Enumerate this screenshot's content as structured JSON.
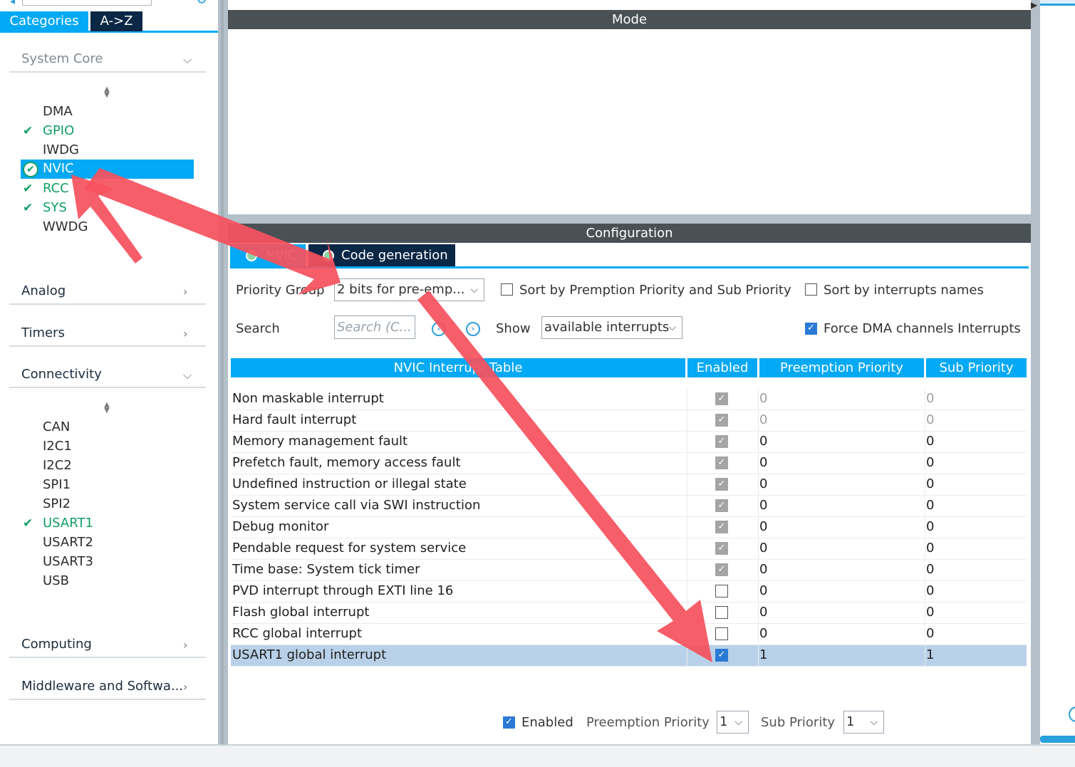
{
  "left": {
    "tabs": {
      "categories": "Categories",
      "az": "A->Z"
    },
    "sections": {
      "system_core": "System Core",
      "analog": "Analog",
      "timers": "Timers",
      "connectivity": "Connectivity",
      "computing": "Computing",
      "middleware": "Middleware and Softwa..."
    },
    "system_core_items": [
      "DMA",
      "GPIO",
      "IWDG",
      "NVIC",
      "RCC",
      "SYS",
      "WWDG"
    ],
    "connectivity_items": [
      "CAN",
      "I2C1",
      "I2C2",
      "SPI1",
      "SPI2",
      "USART1",
      "USART2",
      "USART3",
      "USB"
    ]
  },
  "main": {
    "mode_bar": "Mode",
    "config_bar": "Configuration",
    "tabs": {
      "nvic": "NVIC",
      "code": "Code generation"
    },
    "priority_group_label": "Priority Group",
    "priority_group_value": "2 bits for pre-emp...",
    "sort_premption": "Sort by Premption Priority and Sub Priority",
    "sort_names": "Sort by interrupts names",
    "search_label": "Search",
    "search_placeholder": "Search (C...",
    "show_label": "Show",
    "show_value": "available interrupts",
    "force_dma": "Force DMA channels Interrupts",
    "table": {
      "headers": [
        "NVIC Interrupt Table",
        "Enabled",
        "Preemption Priority",
        "Sub Priority"
      ],
      "rows": [
        {
          "name": "Non maskable interrupt",
          "pre": "0",
          "sub": "0"
        },
        {
          "name": "Hard fault interrupt",
          "pre": "0",
          "sub": "0"
        },
        {
          "name": "Memory management fault",
          "pre": "0",
          "sub": "0"
        },
        {
          "name": "Prefetch fault, memory access fault",
          "pre": "0",
          "sub": "0"
        },
        {
          "name": "Undefined instruction or illegal state",
          "pre": "0",
          "sub": "0"
        },
        {
          "name": "System service call via SWI instruction",
          "pre": "0",
          "sub": "0"
        },
        {
          "name": "Debug monitor",
          "pre": "0",
          "sub": "0"
        },
        {
          "name": "Pendable request for system service",
          "pre": "0",
          "sub": "0"
        },
        {
          "name": "Time base: System tick timer",
          "pre": "0",
          "sub": "0"
        },
        {
          "name": "PVD interrupt through EXTI line 16",
          "pre": "0",
          "sub": "0"
        },
        {
          "name": "Flash global interrupt",
          "pre": "0",
          "sub": "0"
        },
        {
          "name": "RCC global interrupt",
          "pre": "0",
          "sub": "0"
        },
        {
          "name": "USART1 global interrupt",
          "pre": "1",
          "sub": "1"
        }
      ]
    },
    "bottom": {
      "enabled": "Enabled",
      "preemption_label": "Preemption Priority",
      "preemption_value": "1",
      "sub_label": "Sub Priority",
      "sub_value": "1"
    }
  },
  "colors": {
    "accent": "#03a9f4",
    "dark_tab": "#0b2746",
    "green": "#11a067",
    "arrow": "#f5525f"
  }
}
